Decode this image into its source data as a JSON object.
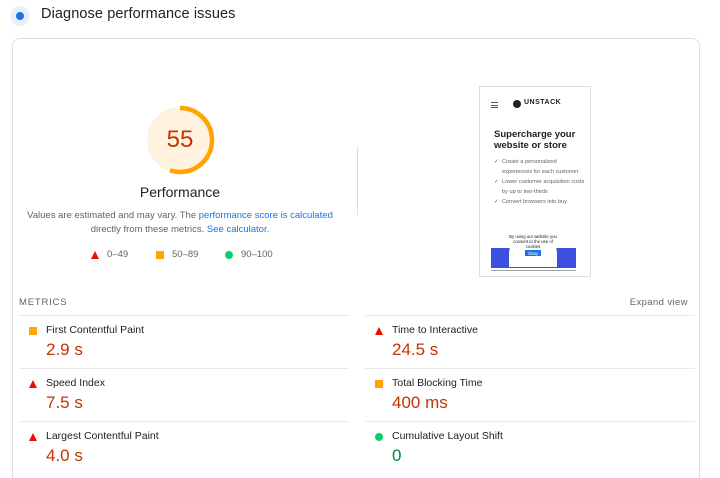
{
  "header": {
    "title": "Diagnose performance issues",
    "icon": "diagnose-icon"
  },
  "score": {
    "value": "55",
    "fraction": 0.55,
    "label": "Performance",
    "color": "#ffa400",
    "bg": "#fff3e0"
  },
  "description": {
    "prefix": "Values are estimated and may vary. The ",
    "link1": "performance score is calculated",
    "middle": "directly from these metrics.",
    "link2": "See calculator",
    "suffix": "."
  },
  "legend": [
    {
      "shape": "triangle",
      "range": "0–49",
      "color": "#eb0f00"
    },
    {
      "shape": "square",
      "range": "50–89",
      "color": "#ffa400"
    },
    {
      "shape": "circle",
      "range": "90–100",
      "color": "#0cce6b"
    }
  ],
  "screenshot": {
    "brand": "UNSTACK",
    "headline": "Supercharge your website or store",
    "bullets": [
      "Create a personalized experiences for each customer",
      "Lower customer acquisition costs by up to two-thirds",
      "Convert browsers into buy"
    ],
    "cookie_text": "By using our website you consent to the use of cookies",
    "cookie_button": "Okay"
  },
  "metrics": {
    "title": "METRICS",
    "expand_label": "Expand view",
    "items": [
      {
        "name": "First Contentful Paint",
        "value": "2.9 s",
        "rating": "average"
      },
      {
        "name": "Time to Interactive",
        "value": "24.5 s",
        "rating": "fail"
      },
      {
        "name": "Speed Index",
        "value": "7.5 s",
        "rating": "fail"
      },
      {
        "name": "Total Blocking Time",
        "value": "400 ms",
        "rating": "average"
      },
      {
        "name": "Largest Contentful Paint",
        "value": "4.0 s",
        "rating": "fail"
      },
      {
        "name": "Cumulative Layout Shift",
        "value": "0",
        "rating": "pass"
      }
    ]
  }
}
